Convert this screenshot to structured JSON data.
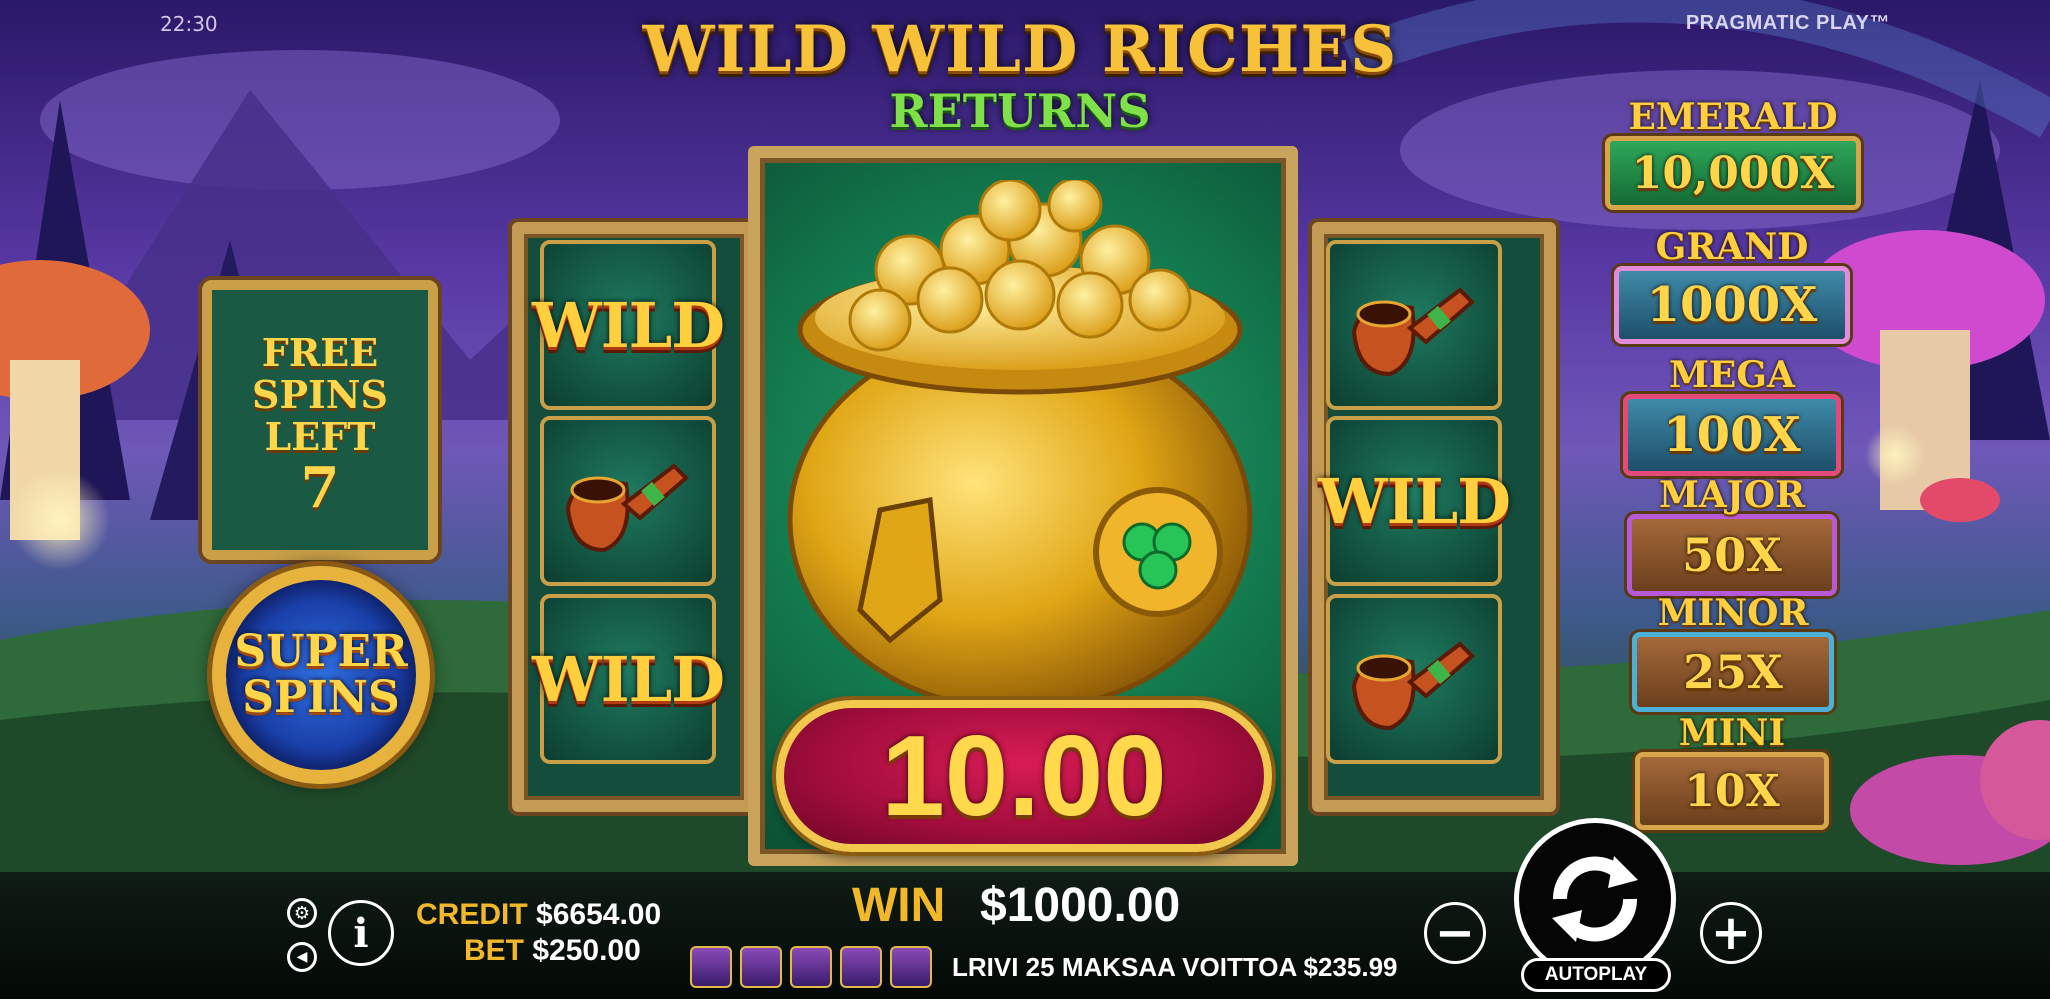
{
  "status": {
    "clock": "22:30",
    "brand": "PRAGMATIC PLAY™"
  },
  "title": {
    "line1": "WILD WILD RICHES",
    "line2": "RETURNS"
  },
  "free_spins": {
    "label": "FREE SPINS LEFT",
    "count": "7"
  },
  "super_spins": {
    "label": "SUPER SPINS"
  },
  "reels": {
    "left": [
      "WILD",
      "pipe",
      "WILD"
    ],
    "center": "pot-of-gold",
    "right": [
      "pipe",
      "WILD",
      "pipe"
    ],
    "wild_label": "WILD"
  },
  "center_win": "10.00",
  "jackpots": [
    {
      "name": "EMERALD",
      "value": "10,000X"
    },
    {
      "name": "GRAND",
      "value": "1000X"
    },
    {
      "name": "MEGA",
      "value": "100X"
    },
    {
      "name": "MAJOR",
      "value": "50X"
    },
    {
      "name": "MINOR",
      "value": "25X"
    },
    {
      "name": "MINI",
      "value": "10X"
    }
  ],
  "bottom": {
    "credit_label": "CREDIT",
    "credit_value": "$6654.00",
    "bet_label": "BET",
    "bet_value": "$250.00",
    "win_label": "WIN",
    "win_value": "$1000.00",
    "line_pays": "LRIVI 25 MAKSAA VOITTOA $235.99",
    "autoplay_label": "AUTOPLAY"
  },
  "icons": [
    "gear-icon",
    "sound-icon",
    "info-icon",
    "minus-icon",
    "plus-icon",
    "spin-icon"
  ],
  "colors": {
    "gold": "#f2b82a",
    "win_pill": "#c0134a",
    "reel_green": "#137a4e"
  }
}
